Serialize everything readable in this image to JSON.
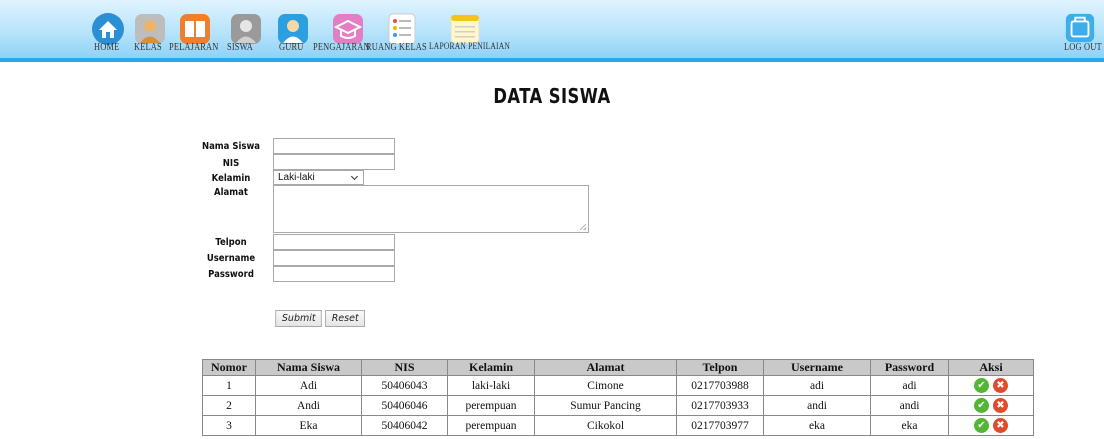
{
  "nav": {
    "items": [
      {
        "label": "HOME",
        "icon": "home-icon"
      },
      {
        "label": "KELAS",
        "icon": "class-icon"
      },
      {
        "label": "PELAJARAN",
        "icon": "book-icon"
      },
      {
        "label": "SISWA",
        "icon": "student-icon"
      },
      {
        "label": "GURU",
        "icon": "teacher-icon"
      },
      {
        "label": "PENGAJARAN",
        "icon": "graduation-cap-icon"
      },
      {
        "label": "RUANG KELAS",
        "icon": "list-icon"
      },
      {
        "label": "LAPORAN PENILAIAN",
        "icon": "notepad-icon"
      }
    ],
    "logout_label": "LOG OUT"
  },
  "title": "DATA SISWA",
  "form": {
    "nama_label": "Nama Siswa",
    "nis_label": "NIS",
    "kelamin_label": "Kelamin",
    "kelamin_value": "Laki-laki",
    "alamat_label": "Alamat",
    "telpon_label": "Telpon",
    "username_label": "Username",
    "password_label": "Password",
    "submit_label": "Submit",
    "reset_label": "Reset"
  },
  "table": {
    "headers": [
      "Nomor",
      "Nama Siswa",
      "NIS",
      "Kelamin",
      "Alamat",
      "Telpon",
      "Username",
      "Password",
      "Aksi"
    ],
    "rows": [
      [
        "1",
        "Adi",
        "50406043",
        "laki-laki",
        "Cimone",
        "0217703988",
        "adi",
        "adi"
      ],
      [
        "2",
        "Andi",
        "50406046",
        "perempuan",
        "Sumur Pancing",
        "0217703933",
        "andi",
        "andi"
      ],
      [
        "3",
        "Eka",
        "50406042",
        "perempuan",
        "Cikokol",
        "0217703977",
        "eka",
        "eka"
      ]
    ]
  },
  "colors": {
    "nav_accent": "#2aa7e6",
    "edit_green": "#52b535",
    "delete_red": "#e24b2a",
    "table_header": "#c9c9c9"
  }
}
